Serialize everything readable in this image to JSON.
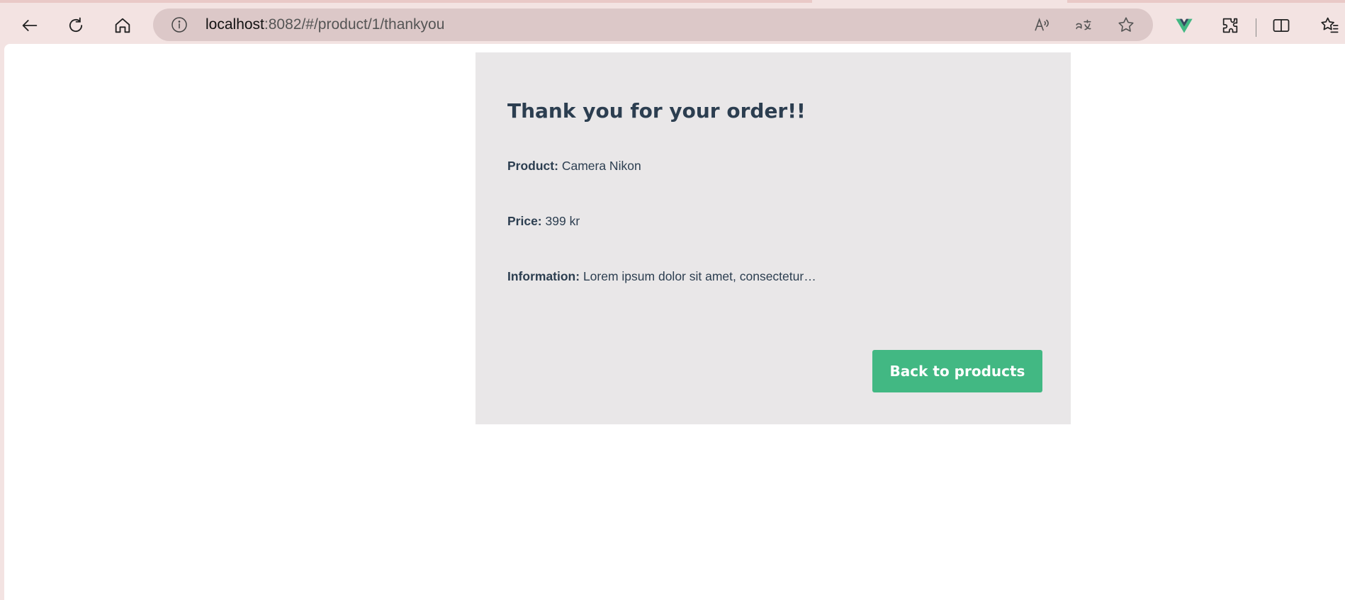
{
  "browser": {
    "url_host": "localhost",
    "url_rest": ":8082/#/product/1/thankyou",
    "icons": [
      "back-icon",
      "refresh-icon",
      "home-icon",
      "info-icon",
      "read-aloud-icon",
      "translate-icon",
      "favorite-star-icon",
      "vue-devtools-icon",
      "extensions-icon",
      "split-screen-icon",
      "favorites-icon"
    ],
    "vue_color": "#42b883"
  },
  "page": {
    "heading": "Thank you for your order!!",
    "product_label": "Product:",
    "product_value": "Camera Nikon",
    "price_label": "Price:",
    "price_value": "399 kr",
    "info_label": "Information:",
    "info_value": "Lorem ipsum dolor sit amet, consectetur…",
    "back_button": "Back to products"
  },
  "colors": {
    "accent": "#42b883",
    "heading": "#2c3e50",
    "card_bg": "#e9e7e8",
    "chrome_bg": "#f3e3e2"
  }
}
